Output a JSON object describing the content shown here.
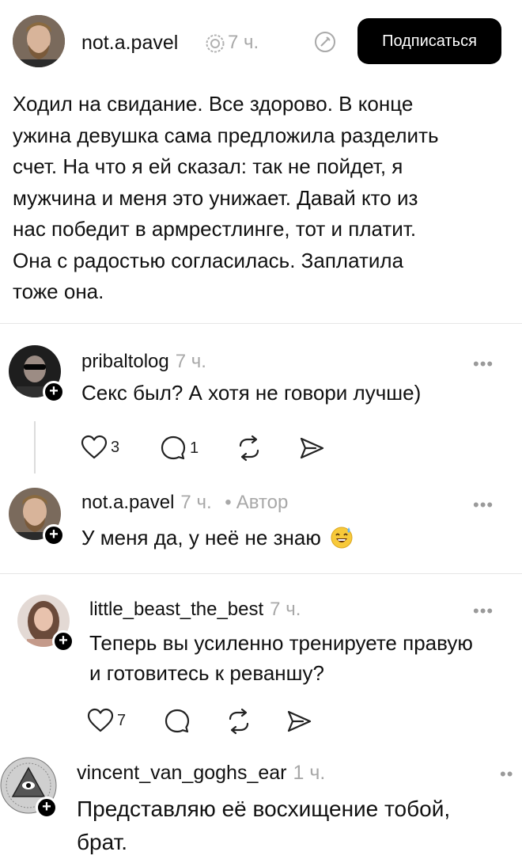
{
  "post": {
    "username": "not.a.pavel",
    "time": "7 ч.",
    "follow_label": "Подписаться",
    "body_lines": [
      "Ходил на свидание. Все здорово. В конце",
      "ужина девушка сама предложила разделить",
      "счет. На что я ей сказал: так не пойдет, я",
      "мужчина и меня это унижает. Давай кто из",
      "нас победит в армрестлинге, тот и платит.",
      "Она с радостью согласилась. Заплатила",
      "тоже она."
    ]
  },
  "comments": [
    {
      "username": "pribaltolog",
      "time": "7 ч.",
      "text_lines": [
        "Секс был? А хотя не говори лучше)"
      ],
      "likes": "3",
      "replies": "1",
      "more": "•••"
    },
    {
      "username": "not.a.pavel",
      "time": "7 ч.",
      "sep": "•",
      "badge": "Автор",
      "text_lines": [
        "У меня да, у неё не знаю"
      ],
      "emoji": "😅",
      "more": "•••"
    },
    {
      "username": "little_beast_the_best",
      "time": "7 ч.",
      "text_lines": [
        "Теперь вы усиленно тренируете правую",
        "и готовитесь к реваншу?"
      ],
      "likes": "7",
      "more": "•••"
    },
    {
      "username": "vincent_van_goghs_ear",
      "time": "1 ч.",
      "text_lines": [
        "Представляю её восхищение тобой,",
        "брат."
      ],
      "more": "••"
    }
  ],
  "icons": [
    "verified-icon",
    "edit-icon",
    "heart-icon",
    "comment-icon",
    "repost-icon",
    "share-icon",
    "plus-icon",
    "more-icon"
  ],
  "colors": {
    "button_bg": "#000000",
    "muted": "#a8a8a8",
    "divider": "#e6e6e6"
  }
}
